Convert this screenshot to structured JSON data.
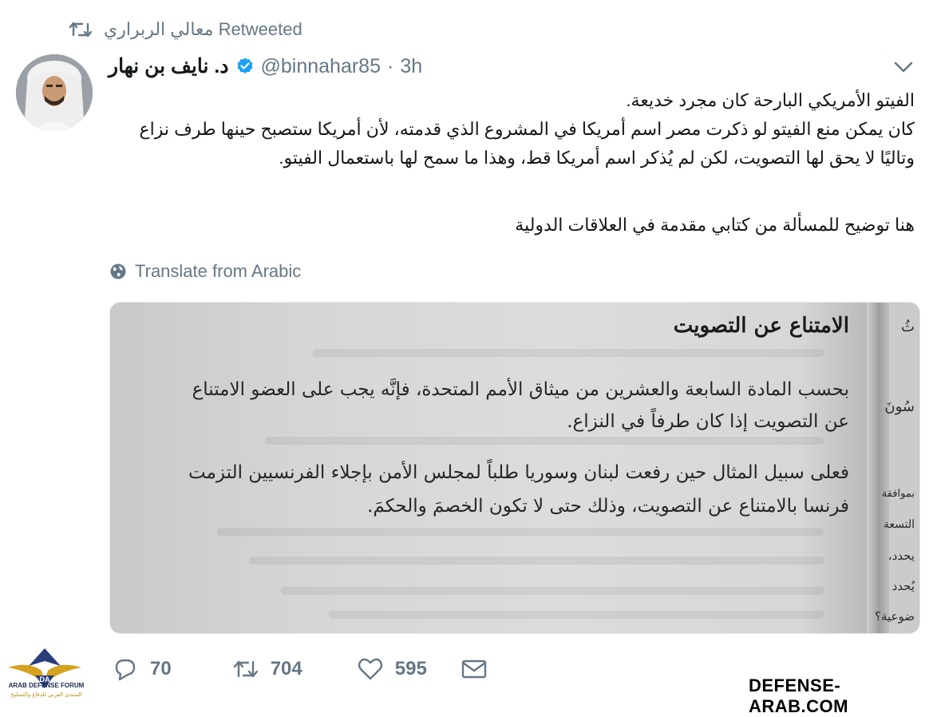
{
  "retweet": {
    "retweeter": "معالي الربراري",
    "label": "Retweeted"
  },
  "tweet": {
    "display_name": "د. نايف بن نهار",
    "handle": "@binnahar85",
    "separator": "·",
    "time": "3h",
    "lines": [
      "الفيتو الأمريكي البارحة كان مجرد خديعة.",
      "كان يمكن منع الفيتو لو ذكرت مصر اسم أمريكا في المشروع الذي قدمته، لأن أمريكا ستصبح حينها طرف نزاع",
      "وتاليًا لا يحق لها التصويت، لكن لم يُذكر اسم أمريكا قط، وهذا ما سمح لها باستعمال الفيتو.",
      "هنا توضيح للمسألة من كتابي مقدمة في العلاقات الدولية"
    ],
    "translate_label": "Translate from Arabic"
  },
  "media": {
    "heading": "الامتناع عن التصويت",
    "paragraph1": [
      "بحسب المادة السابعة والعشرين من ميثاق الأمم المتحدة، فإنَّه يجب على العضو الامتناع",
      "عن التصويت إذا كان طرفاً في النزاع."
    ],
    "paragraph2": [
      "فعلى سبيل المثال حين رفعت لبنان وسوريا طلباً لمجلس الأمن بإجلاء الفرنسيين التزمت",
      "فرنسا بالامتناع عن التصويت، وذلك حتى لا تكون الخصمَ والحكمَ."
    ],
    "right_page_fragments": [
      "ثُ",
      "سُونَ",
      "بموافقة",
      "التسعة",
      "يحدد،",
      "يُحدد",
      "ضوعية؟"
    ]
  },
  "actions": {
    "replies": "70",
    "retweets": "704",
    "likes": "595"
  },
  "watermark": {
    "logo_text": "DA",
    "forum_en": "ARAB DEFENSE FORUM",
    "forum_ar": "المنتدى العربي للدفاع والتسليح",
    "site": "DEFENSE-ARAB.COM"
  },
  "icons": {
    "retweet": "retweet-icon",
    "verified": "verified-badge-icon",
    "chevron": "chevron-down-icon",
    "globe": "globe-icon",
    "reply": "reply-icon",
    "like": "heart-icon",
    "dm": "envelope-icon"
  },
  "colors": {
    "secondary_text": "#657786",
    "verified": "#1da1f2",
    "text": "#14171a"
  }
}
